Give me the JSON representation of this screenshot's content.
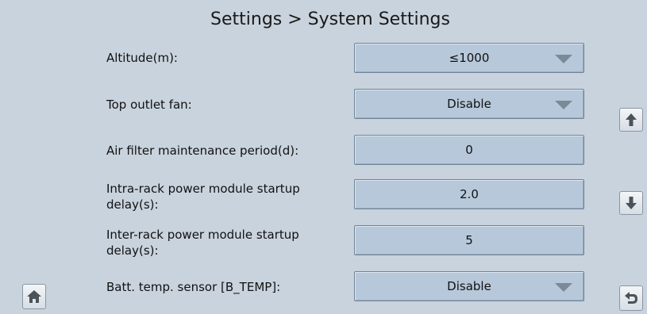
{
  "header": {
    "title": "Settings > System Settings"
  },
  "rows": [
    {
      "label": "Altitude(m):",
      "value": "≤1000",
      "control": "dropdown"
    },
    {
      "label": "Top outlet fan:",
      "value": "Disable",
      "control": "dropdown"
    },
    {
      "label": "Air filter maintenance period(d):",
      "value": "0",
      "control": "input"
    },
    {
      "label": "Intra-rack power module startup delay(s):",
      "value": "2.0",
      "control": "input"
    },
    {
      "label": "Inter-rack power module startup delay(s):",
      "value": "5",
      "control": "input"
    },
    {
      "label": "Batt. temp. sensor [B_TEMP]:",
      "value": "Disable",
      "control": "dropdown"
    }
  ],
  "nav": {
    "scroll_up_icon": "arrow-up-icon",
    "scroll_down_icon": "arrow-down-icon",
    "home_icon": "home-icon",
    "back_icon": "back-icon"
  },
  "colors": {
    "background": "#c9d3dd",
    "field_fill": "#b7c8da",
    "field_border": "#6f8296"
  }
}
